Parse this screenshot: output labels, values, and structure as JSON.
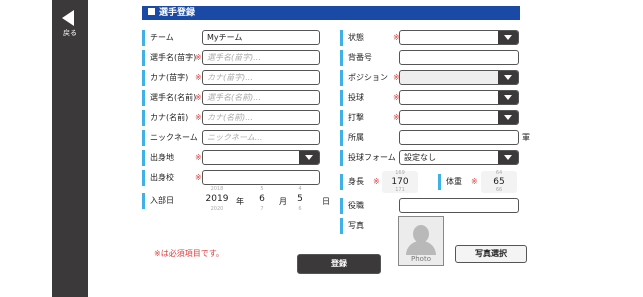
{
  "nav": {
    "back_label": "戻る"
  },
  "section": {
    "title": "選手登録"
  },
  "required_mark": "※",
  "left_fields": [
    {
      "key": "team",
      "label": "チーム",
      "required": false,
      "value": "Myチーム",
      "placeholder": ""
    },
    {
      "key": "last_name",
      "label": "選手名(苗字)",
      "required": true,
      "value": "",
      "placeholder": "選手名(苗字)..."
    },
    {
      "key": "last_kana",
      "label": "カナ(苗字)",
      "required": true,
      "value": "",
      "placeholder": "カナ(苗字)..."
    },
    {
      "key": "first_name",
      "label": "選手名(名前)",
      "required": true,
      "value": "",
      "placeholder": "選手名(名前)..."
    },
    {
      "key": "first_kana",
      "label": "カナ(名前)",
      "required": true,
      "value": "",
      "placeholder": "カナ(名前)..."
    },
    {
      "key": "nickname",
      "label": "ニックネーム",
      "required": false,
      "value": "",
      "placeholder": "ニックネーム..."
    },
    {
      "key": "hometown",
      "label": "出身地",
      "required": true,
      "value": "",
      "type": "select"
    },
    {
      "key": "school",
      "label": "出身校",
      "required": true,
      "value": "",
      "placeholder": ""
    }
  ],
  "enrollment": {
    "label": "入部日",
    "year": {
      "prev": "2018",
      "value": "2019",
      "next": "2020",
      "unit": "年"
    },
    "month": {
      "prev": "5",
      "value": "6",
      "next": "7",
      "unit": "月"
    },
    "day": {
      "prev": "4",
      "value": "5",
      "next": "6",
      "unit": "日"
    }
  },
  "right_fields": [
    {
      "key": "status",
      "label": "状態",
      "required": true,
      "value": "",
      "type": "select"
    },
    {
      "key": "number",
      "label": "背番号",
      "required": false,
      "value": ""
    },
    {
      "key": "position",
      "label": "ポジション",
      "required": true,
      "value": "",
      "type": "select",
      "disabled": true
    },
    {
      "key": "throw",
      "label": "投球",
      "required": true,
      "value": "",
      "type": "select"
    },
    {
      "key": "bat",
      "label": "打撃",
      "required": true,
      "value": "",
      "type": "select"
    },
    {
      "key": "affiliation",
      "label": "所属",
      "required": false,
      "value": "",
      "unit": "軍"
    },
    {
      "key": "pitch_form",
      "label": "投球フォーム",
      "required": false,
      "value": "設定なし",
      "type": "select"
    }
  ],
  "height": {
    "label": "身長",
    "prev": "169",
    "value": "170",
    "next": "171"
  },
  "weight": {
    "label": "体重",
    "prev": "64",
    "value": "65",
    "next": "66"
  },
  "role": {
    "label": "役職",
    "value": ""
  },
  "photo": {
    "label": "写真",
    "caption": "Photo",
    "select_button": "写真選択"
  },
  "footer": {
    "required_note": "※は必須項目です。",
    "register_button": "登録"
  }
}
